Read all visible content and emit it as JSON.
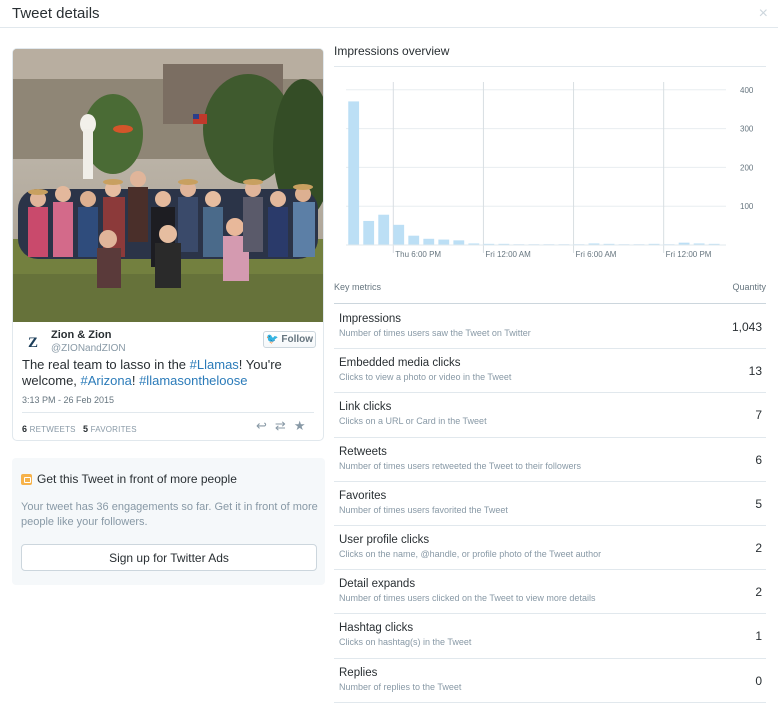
{
  "header": {
    "title": "Tweet details",
    "close": "×"
  },
  "tweet": {
    "author_name": "Zion & Zion",
    "handle": "@ZIONandZION",
    "avatar_letter": "Z",
    "follow_label": "Follow",
    "text_parts": [
      {
        "t": "The real team to lasso in the ",
        "tag": false
      },
      {
        "t": "#Llamas",
        "tag": true
      },
      {
        "t": "! You're welcome, ",
        "tag": false
      },
      {
        "t": "#Arizona",
        "tag": true
      },
      {
        "t": "! ",
        "tag": false
      },
      {
        "t": "#llamasontheloose",
        "tag": true
      }
    ],
    "time": "3:13 PM - 26 Feb 2015",
    "retweets_count": "6",
    "retweets_label": "RETWEETS",
    "favorites_count": "5",
    "favorites_label": "FAVORITES"
  },
  "promo": {
    "title": "Get this Tweet in front of more people",
    "text": "Your tweet has 36 engagements so far. Get it in front of more people like your followers.",
    "button": "Sign up for Twitter Ads"
  },
  "impressions": {
    "title": "Impressions overview"
  },
  "chart_data": {
    "type": "bar",
    "title": "Impressions overview",
    "xlabel": "",
    "ylabel": "",
    "ylim": [
      0,
      420
    ],
    "yticks": [
      100,
      200,
      300,
      400
    ],
    "x_tick_labels": [
      "Thu 6:00 PM",
      "Fri 12:00 AM",
      "Fri 6:00 AM",
      "Fri 12:00 PM"
    ],
    "x_tick_positions": [
      3,
      9,
      15,
      21
    ],
    "values": [
      370,
      62,
      78,
      52,
      24,
      16,
      14,
      12,
      4,
      3,
      3,
      2,
      2,
      2,
      2,
      2,
      4,
      3,
      2,
      2,
      3,
      2,
      6,
      4,
      3
    ],
    "grid": true,
    "color": "#bcdff5"
  },
  "metrics": {
    "header_left": "Key metrics",
    "header_right": "Quantity",
    "rows": [
      {
        "name": "Impressions",
        "desc": "Number of times users saw the Tweet on Twitter",
        "qty": "1,043"
      },
      {
        "name": "Embedded media clicks",
        "desc": "Clicks to view a photo or video in the Tweet",
        "qty": "13"
      },
      {
        "name": "Link clicks",
        "desc": "Clicks on a URL or Card in the Tweet",
        "qty": "7"
      },
      {
        "name": "Retweets",
        "desc": "Number of times users retweeted the Tweet to their followers",
        "qty": "6"
      },
      {
        "name": "Favorites",
        "desc": "Number of times users favorited the Tweet",
        "qty": "5"
      },
      {
        "name": "User profile clicks",
        "desc": "Clicks on the name, @handle, or profile photo of the Tweet author",
        "qty": "2"
      },
      {
        "name": "Detail expands",
        "desc": "Number of times users clicked on the Tweet to view more details",
        "qty": "2"
      },
      {
        "name": "Hashtag clicks",
        "desc": "Clicks on hashtag(s) in the Tweet",
        "qty": "1"
      },
      {
        "name": "Replies",
        "desc": "Number of replies to the Tweet",
        "qty": "0"
      }
    ]
  }
}
